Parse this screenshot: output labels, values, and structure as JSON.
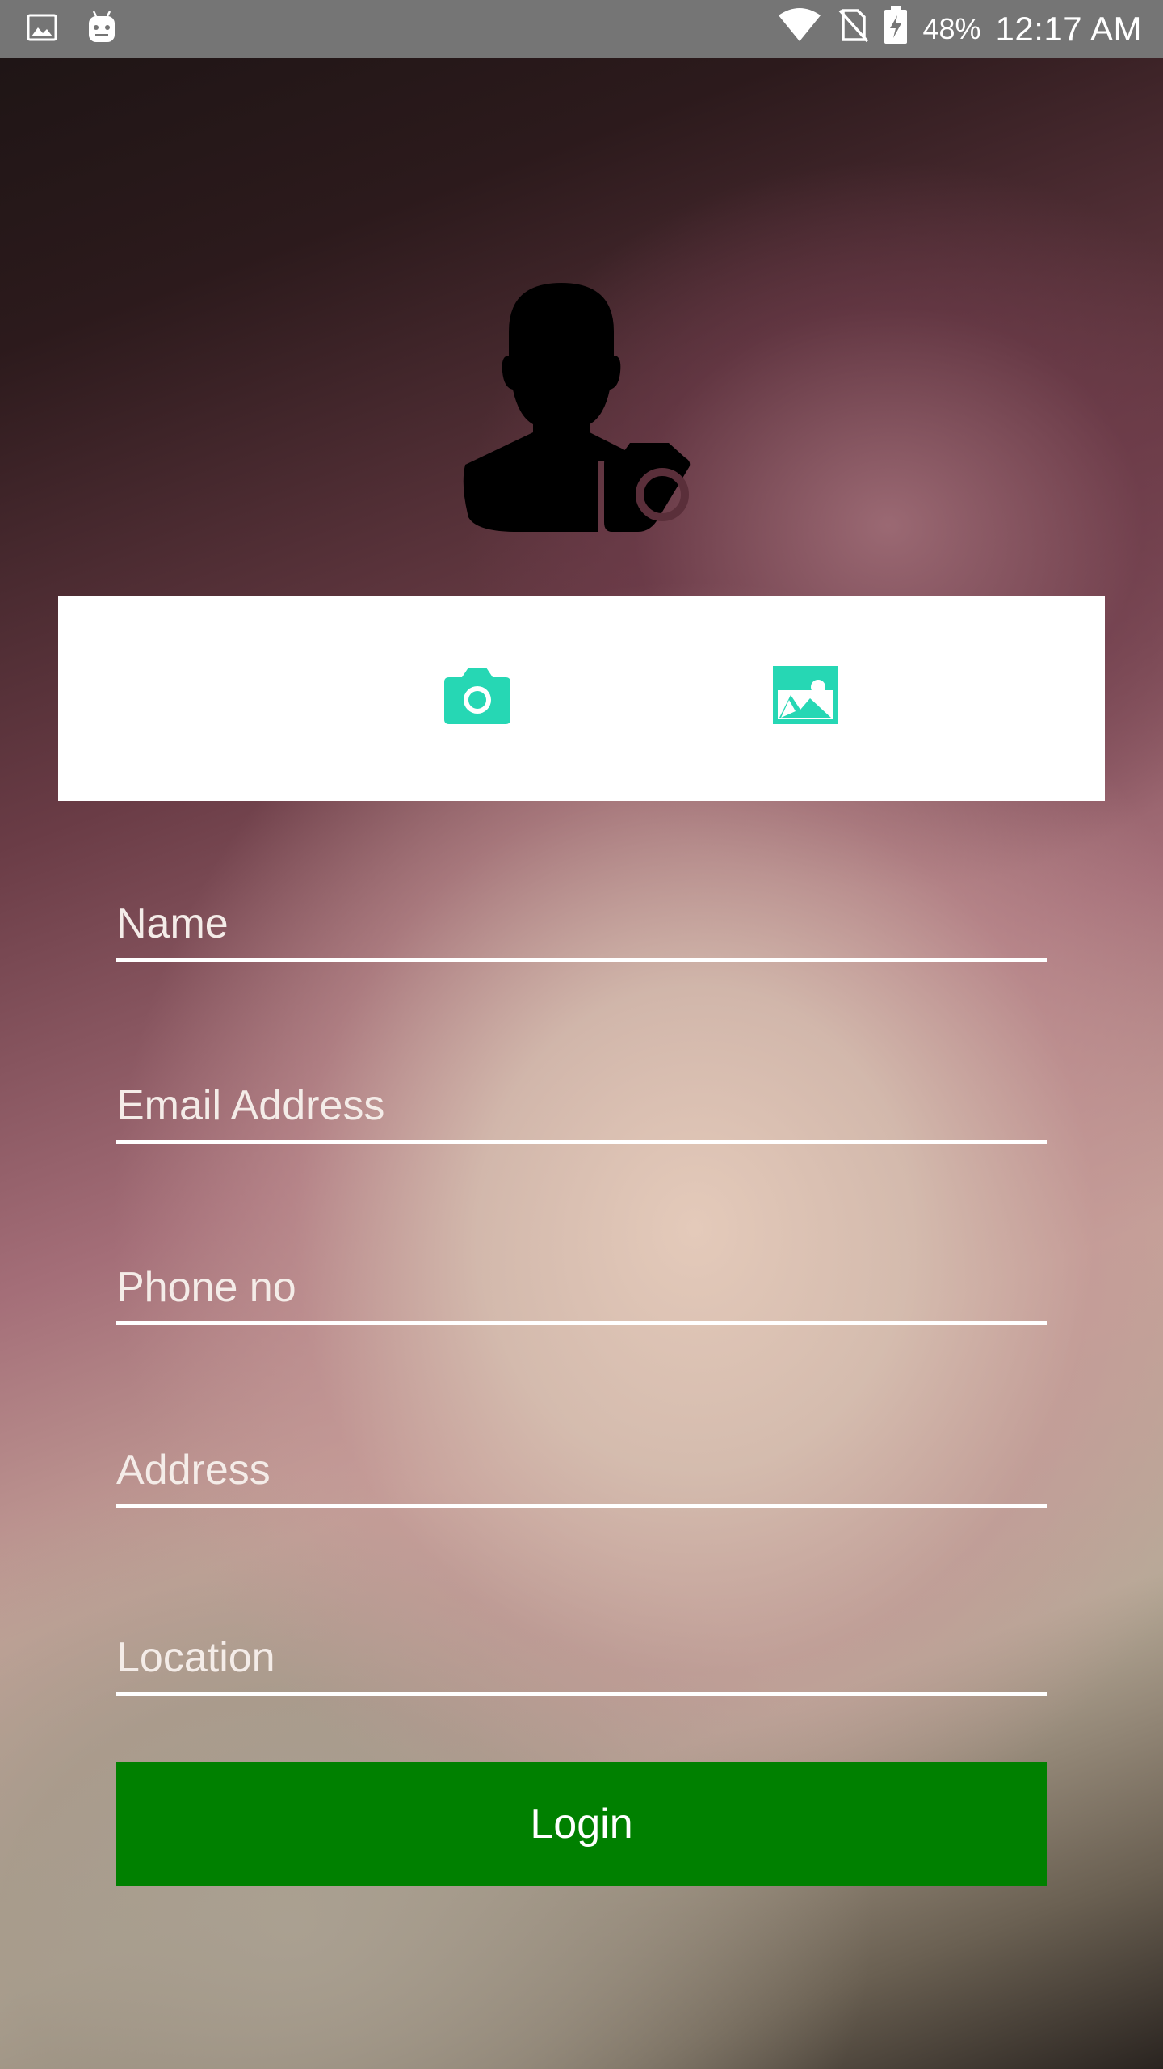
{
  "status_bar": {
    "left_icons": [
      "image-notification-icon",
      "android-icon"
    ],
    "right_icons": [
      "wifi-icon",
      "no-sim-icon",
      "battery-charging-icon"
    ],
    "battery_percent": "48%",
    "time": "12:17 AM"
  },
  "avatar": {
    "icon": "user-camera-avatar-icon"
  },
  "photo_picker": {
    "camera_icon": "camera-icon",
    "gallery_icon": "gallery-icon",
    "accent_color": "#26D7B4"
  },
  "form": {
    "name_placeholder": "Name",
    "email_placeholder": "Email Address",
    "phone_placeholder": "Phone no",
    "address_placeholder": "Address",
    "location_placeholder": "Location"
  },
  "login_button": {
    "label": "Login",
    "color": "#008000"
  }
}
